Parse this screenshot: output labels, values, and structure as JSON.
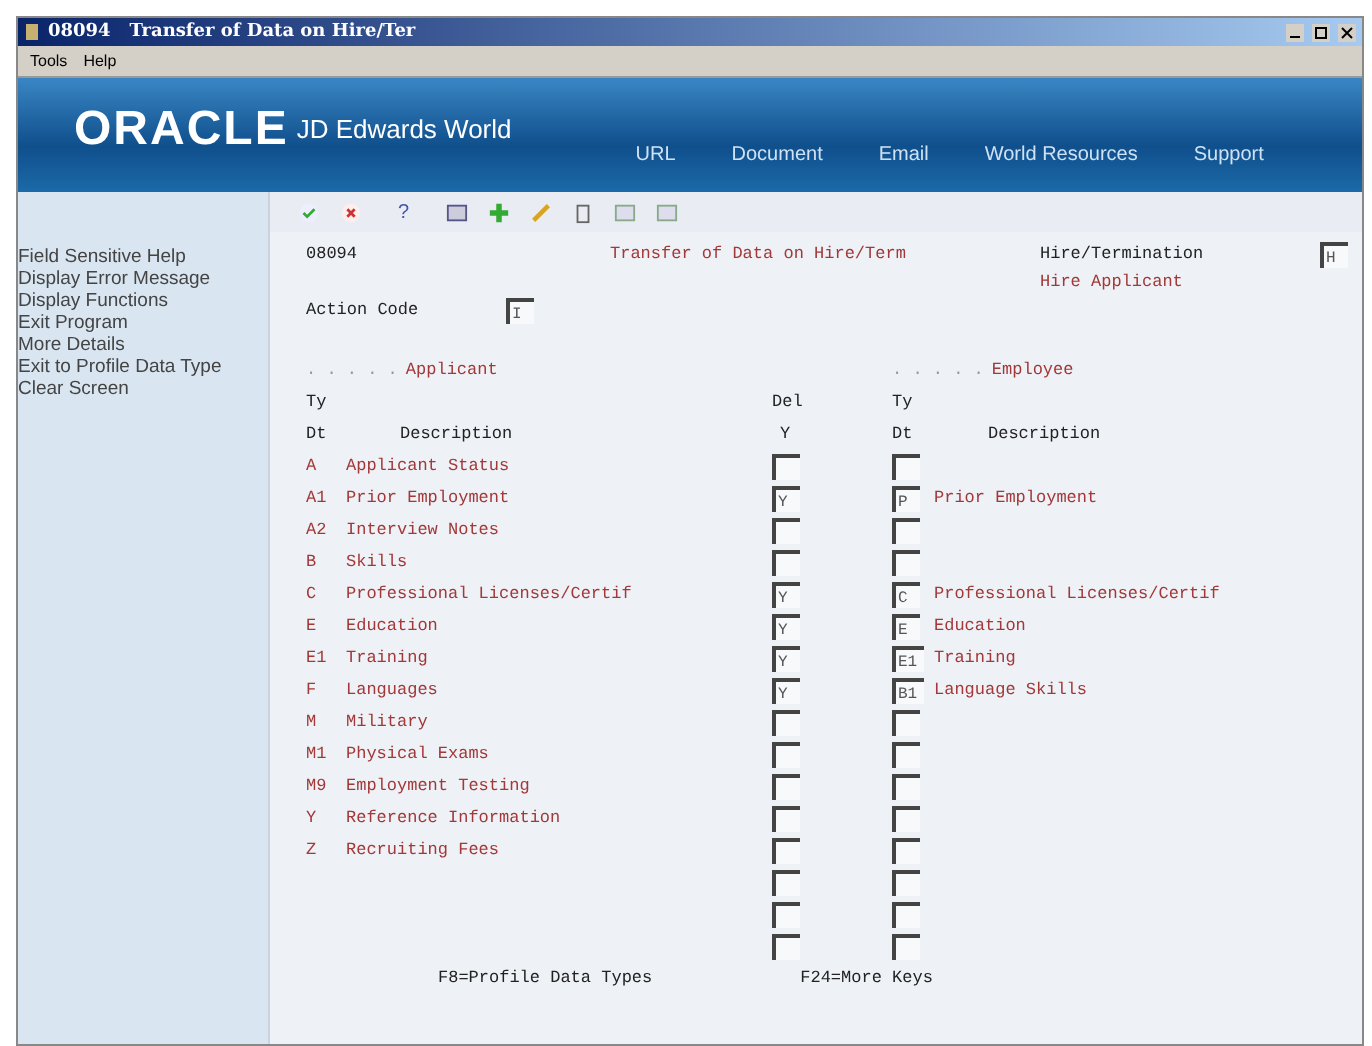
{
  "window": {
    "title": "08094   Transfer of Data on Hire/Ter"
  },
  "menu": [
    "Tools",
    "Help"
  ],
  "banner": {
    "brand": "ORACLE",
    "product": "JD Edwards World",
    "links": [
      "URL",
      "Document",
      "Email",
      "World Resources",
      "Support"
    ]
  },
  "toolbar": {
    "help_label": "?"
  },
  "sidebar": {
    "items": [
      "Field Sensitive Help",
      "Display Error Message",
      "Display Functions",
      "Exit Program",
      "More Details",
      "Exit to Profile Data Type",
      "Clear Screen"
    ]
  },
  "form": {
    "program": "08094",
    "heading": "Transfer of Data on Hire/Term",
    "mode_label": "Hire/Termination",
    "mode_value": "H",
    "mode_desc": "Hire Applicant",
    "action_label": "Action Code",
    "action_value": "I",
    "applicant_leader": ". . . . .",
    "applicant_title": "Applicant",
    "employee_leader": ". . . . .",
    "employee_title": "Employee",
    "col_ty": "Ty",
    "col_dt": "Dt",
    "col_desc": "Description",
    "col_del": "Del",
    "col_del_y": "Y",
    "emp_col_ty": "Ty",
    "emp_col_dt": "Dt",
    "emp_col_desc": "Description",
    "rows": [
      {
        "kind": "entry",
        "ty": "A",
        "desc": "Applicant Status"
      },
      {
        "kind": "entry",
        "ty": "A1",
        "desc": "Prior Employment",
        "del": "Y",
        "emp_ty": "P",
        "emp_desc": "Prior Employment"
      },
      {
        "kind": "entry",
        "ty": "A2",
        "desc": "Interview Notes"
      },
      {
        "kind": "entry",
        "ty": "B",
        "desc": "Skills"
      },
      {
        "kind": "entry",
        "ty": "C",
        "desc": "Professional Licenses/Certif",
        "del": "Y",
        "emp_ty": "C",
        "emp_desc": "Professional Licenses/Certif"
      },
      {
        "kind": "entry",
        "ty": "E",
        "desc": "Education",
        "del": "Y",
        "emp_ty": "E",
        "emp_desc": "Education"
      },
      {
        "kind": "entry",
        "ty": "E1",
        "desc": "Training",
        "del": "Y",
        "emp_ty": "E1",
        "emp_desc": "Training"
      },
      {
        "kind": "entry",
        "ty": "F",
        "desc": "Languages",
        "del": "Y",
        "emp_ty": "B1",
        "emp_desc": "Language Skills"
      },
      {
        "kind": "entry",
        "ty": "M",
        "desc": "Military"
      },
      {
        "kind": "entry",
        "ty": "M1",
        "desc": "Physical Exams"
      },
      {
        "kind": "entry",
        "ty": "M9",
        "desc": "Employment Testing"
      },
      {
        "kind": "entry",
        "ty": "Y",
        "desc": "Reference Information"
      },
      {
        "kind": "entry",
        "ty": "Z",
        "desc": "Recruiting Fees"
      },
      {
        "kind": "blank"
      },
      {
        "kind": "blank"
      },
      {
        "kind": "blank"
      }
    ],
    "footer": [
      "F8=Profile Data Types",
      "F24=More Keys"
    ]
  }
}
